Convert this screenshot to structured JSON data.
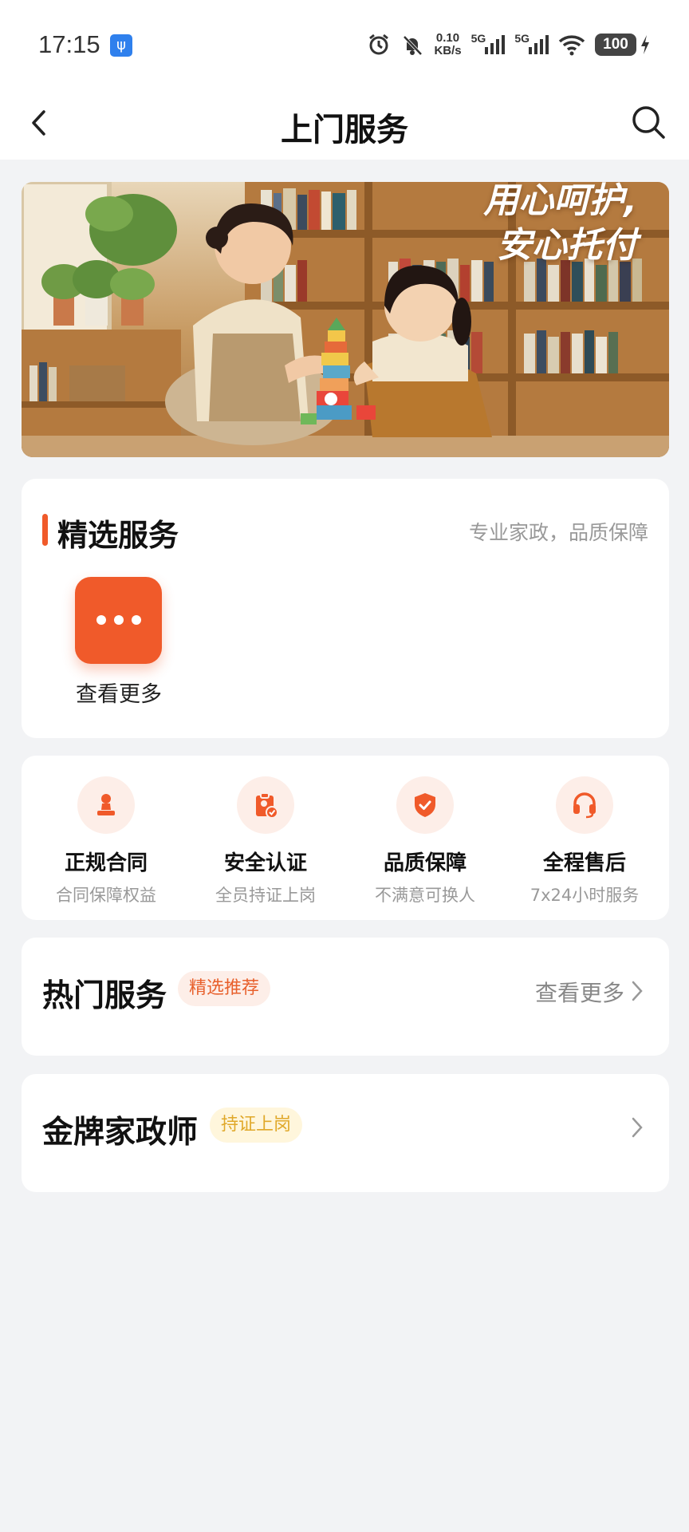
{
  "status_bar": {
    "time": "17:15",
    "usb_icon": "usb-icon",
    "net_speed_value": "0.10",
    "net_speed_unit": "KB/s",
    "signal_1": "5G",
    "signal_2": "5G",
    "battery": "100"
  },
  "nav": {
    "title": "上门服务",
    "back_icon": "chevron-left-icon",
    "search_icon": "search-icon"
  },
  "banner": {
    "slogan_line1": "用心呵护,",
    "slogan_line2": "安心托付"
  },
  "featured": {
    "title": "精选服务",
    "subtitle": "专业家政，品质保障",
    "more_label": "查看更多"
  },
  "features": [
    {
      "title": "正规合同",
      "sub": "合同保障权益",
      "icon": "stamp-icon"
    },
    {
      "title": "安全认证",
      "sub": "全员持证上岗",
      "icon": "clipboard-check-icon"
    },
    {
      "title": "品质保障",
      "sub": "不满意可换人",
      "icon": "shield-check-icon"
    },
    {
      "title": "全程售后",
      "sub": "7x24小时服务",
      "icon": "headset-icon"
    }
  ],
  "hot_services": {
    "title": "热门服务",
    "tag": "精选推荐",
    "more": "查看更多"
  },
  "gold_staff": {
    "title": "金牌家政师",
    "tag": "持证上岗"
  },
  "colors": {
    "accent": "#f05a2a",
    "tag_red_bg": "#fdeee8",
    "tag_yellow_text": "#e0a82a",
    "page_bg": "#f2f3f5"
  }
}
